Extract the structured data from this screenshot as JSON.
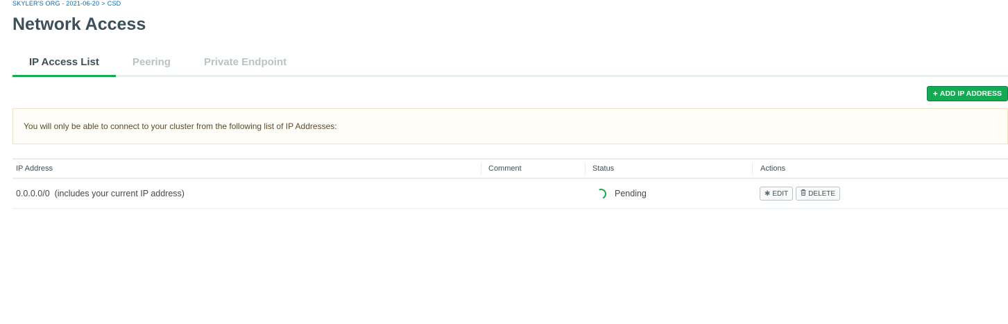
{
  "breadcrumb": {
    "org": "SKYLER'S ORG - 2021-06-20",
    "separator": ">",
    "project": "CSD"
  },
  "page": {
    "title": "Network Access"
  },
  "tabs": [
    {
      "label": "IP Access List",
      "active": true
    },
    {
      "label": "Peering",
      "active": false
    },
    {
      "label": "Private Endpoint",
      "active": false
    }
  ],
  "toolbar": {
    "add_icon": "+",
    "add_label": "ADD IP ADDRESS"
  },
  "banner": {
    "text": "You will only be able to connect to your cluster from the following list of IP Addresses:"
  },
  "table": {
    "columns": [
      "IP Address",
      "Comment",
      "Status",
      "Actions"
    ],
    "rows": [
      {
        "ip": "0.0.0.0/0  (includes your current IP address)",
        "comment": "",
        "status": "Pending",
        "edit_label": "EDIT",
        "delete_label": "DELETE"
      }
    ]
  },
  "icons": {
    "edit": "gear-icon",
    "delete": "trash-icon",
    "status": "spinner-icon"
  },
  "colors": {
    "accent": "#13aa52",
    "link": "#006cbc",
    "banner_bg": "#fefdf7"
  }
}
